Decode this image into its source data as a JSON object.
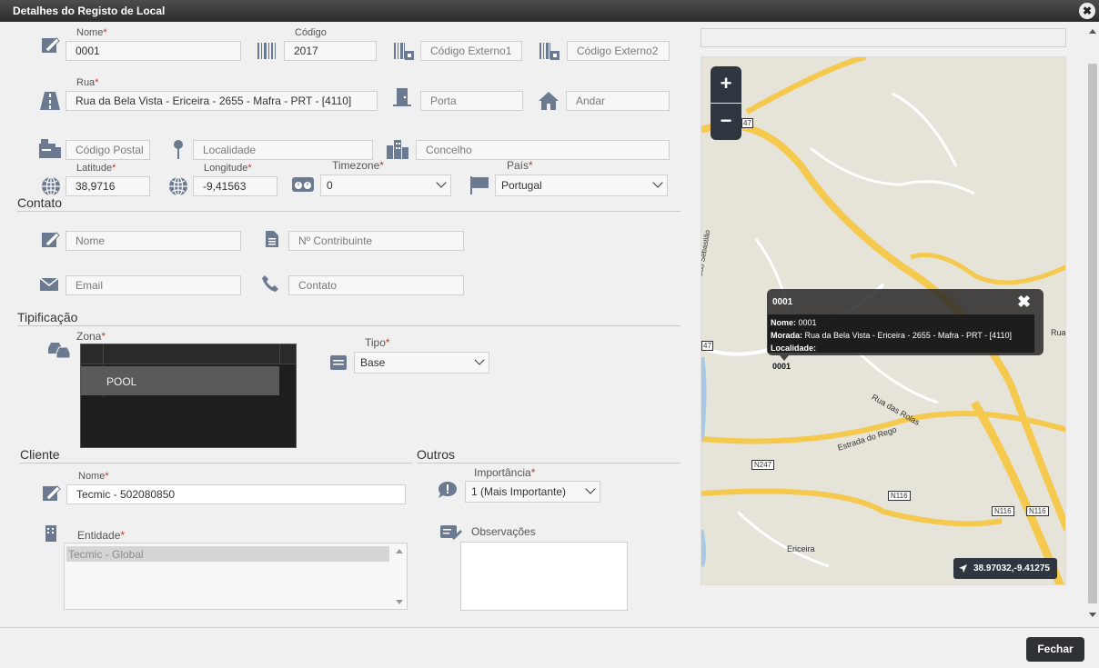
{
  "window": {
    "title": "Detalhes do Registo de Local",
    "close_icon": "close-icon"
  },
  "local": {
    "nome_label": "Nome",
    "nome_value": "0001",
    "codigo_label": "Código",
    "codigo_value": "2017",
    "codigo_externo1_placeholder": "Código Externo1",
    "codigo_externo2_placeholder": "Código Externo2",
    "rua_label": "Rua",
    "rua_value": "Rua da Bela Vista - Ericeira - 2655 - Mafra - PRT - [4110]",
    "porta_placeholder": "Porta",
    "andar_placeholder": "Andar",
    "codigo_postal_placeholder": "Código Postal",
    "localidade_placeholder": "Localidade",
    "concelho_placeholder": "Concelho",
    "latitude_label": "Latitude",
    "latitude_value": "38,9716",
    "longitude_label": "Longitude",
    "longitude_value": "-9,41563",
    "timezone_label": "Timezone",
    "timezone_value": "0",
    "pais_label": "País",
    "pais_value": "Portugal"
  },
  "contato": {
    "section_title": "Contato",
    "nome_placeholder": "Nome",
    "contribuinte_placeholder": "Nº Contribuinte",
    "email_placeholder": "Email",
    "contato_placeholder": "Contato"
  },
  "tipificacao": {
    "section_title": "Tipificação",
    "zona_label": "Zona",
    "zona_items": [
      "POOL"
    ],
    "tipo_label": "Tipo",
    "tipo_value": "Base"
  },
  "cliente": {
    "section_title": "Cliente",
    "nome_label": "Nome",
    "nome_value": "Tecmic - 502080850",
    "entidade_label": "Entidade",
    "entidade_value": "Tecmic - Global"
  },
  "outros": {
    "section_title": "Outros",
    "importancia_label": "Importância",
    "importancia_value": "1 (Mais Importante)",
    "observacoes_label": "Observações"
  },
  "map": {
    "zoom_in": "+",
    "zoom_out": "−",
    "marker_label": "0001",
    "popup": {
      "title": "0001",
      "nome_key": "Nome:",
      "nome_val": "0001",
      "morada_key": "Morada:",
      "morada_val": "Rua da Bela Vista - Ericeira - 2655 - Mafra - PRT - [4110]",
      "localidade_key": "Localidade:",
      "localidade_val": ""
    },
    "coords": "38.97032,-9.41275",
    "road_labels": [
      "N247",
      "N116",
      "N116",
      "N116",
      "47",
      "47",
      "Rua"
    ],
    "street_labels": [
      "Rua das Rolas",
      "Estrada do Rego",
      "Ericeira",
      "Rua de São Sebastião"
    ]
  },
  "footer": {
    "fechar_label": "Fechar"
  }
}
